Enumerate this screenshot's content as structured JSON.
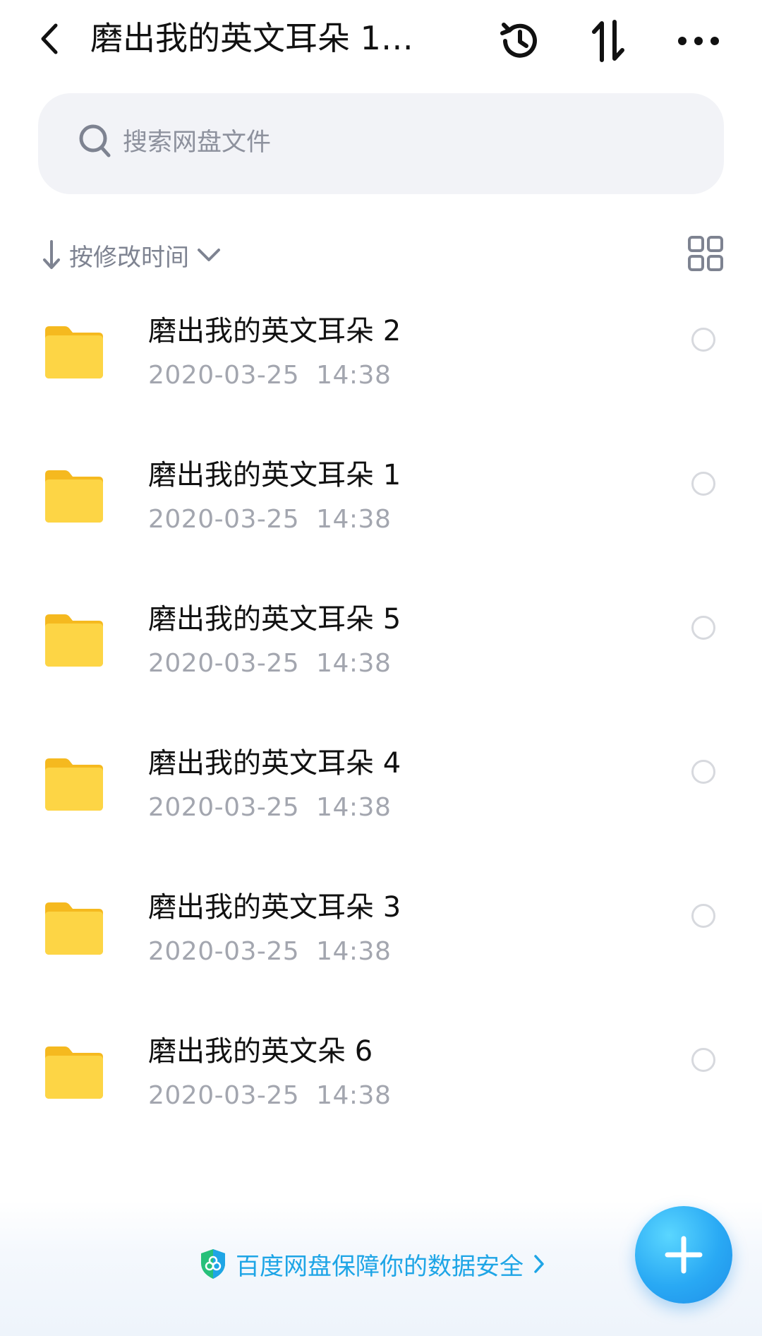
{
  "header": {
    "title": "磨出我的英文耳朵 1…",
    "back_icon": "chevron-left-icon",
    "history_icon": "history-icon",
    "transfer_icon": "transfer-icon",
    "more_icon": "more-icon"
  },
  "search": {
    "placeholder": "搜索网盘文件",
    "icon": "search-icon"
  },
  "sort": {
    "label": "按修改时间",
    "view_icon": "grid-view-icon"
  },
  "files": [
    {
      "name": "磨出我的英文耳朵 2",
      "date": "2020-03-25",
      "time": "14:38"
    },
    {
      "name": "磨出我的英文耳朵 1",
      "date": "2020-03-25",
      "time": "14:38"
    },
    {
      "name": "磨出我的英文耳朵 5",
      "date": "2020-03-25",
      "time": "14:38"
    },
    {
      "name": "磨出我的英文耳朵 4",
      "date": "2020-03-25",
      "time": "14:38"
    },
    {
      "name": "磨出我的英文耳朵 3",
      "date": "2020-03-25",
      "time": "14:38"
    },
    {
      "name": "磨出我的英文朵 6",
      "date": "2020-03-25",
      "time": "14:38"
    }
  ],
  "footer": {
    "security_text": "百度网盘保障你的数据安全",
    "fab_icon": "plus-icon"
  },
  "colors": {
    "accent": "#1ea5e6",
    "folder": "#fccf3a",
    "search_bg": "#f2f3f7",
    "muted_text": "#a3a6af"
  }
}
